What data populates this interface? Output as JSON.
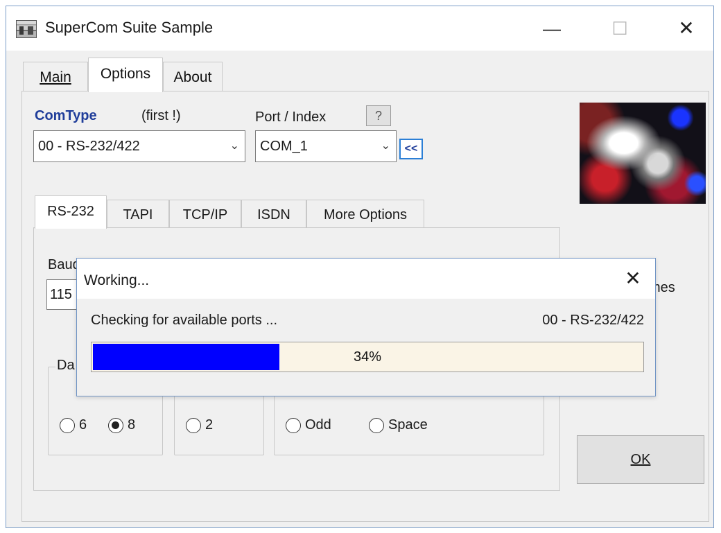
{
  "window": {
    "title": "SuperCom Suite Sample",
    "minimize": "—",
    "maximize": "☐",
    "close": "✕"
  },
  "main_tabs": [
    {
      "label": "Main",
      "active": false
    },
    {
      "label": "Options",
      "active": true
    },
    {
      "label": "About",
      "active": false
    }
  ],
  "options": {
    "comtype_label": "ComType",
    "first_label": "(first !)",
    "port_label": "Port / Index",
    "help_label": "?",
    "comtype_value": "00 - RS-232/422",
    "port_value": "COM_1",
    "back_label": "<<"
  },
  "inner_tabs": [
    {
      "label": "RS-232",
      "active": true
    },
    {
      "label": "TAPI",
      "active": false
    },
    {
      "label": "TCP/IP",
      "active": false
    },
    {
      "label": "ISDN",
      "active": false
    },
    {
      "label": "More Options",
      "active": false
    }
  ],
  "rs232": {
    "baud_label": "Baud",
    "baud_value": "115",
    "data_group_label": "Da",
    "data_options": [
      {
        "label": "6",
        "checked": false
      },
      {
        "label": "8",
        "checked": true
      }
    ],
    "stop_options": [
      {
        "label": "2",
        "checked": false
      }
    ],
    "parity_options": [
      {
        "label": "Odd",
        "checked": false
      },
      {
        "label": "Space",
        "checked": false
      }
    ]
  },
  "times_label": "mes",
  "ok_label": "OK",
  "dialog": {
    "title": "Working...",
    "close": "✕",
    "message": "Checking for available ports ...",
    "port_type": "00 - RS-232/422",
    "progress_percent": 34,
    "progress_text": "34%"
  },
  "colors": {
    "progress_fill": "#0000ff",
    "progress_track": "#faf4e6",
    "comtype_label": "#1f3d9a",
    "accent_border": "#2b7fd6"
  },
  "icons": {
    "app": "app-icon",
    "combo_arrow": "chevron-down-icon",
    "image": "satellite-image"
  }
}
